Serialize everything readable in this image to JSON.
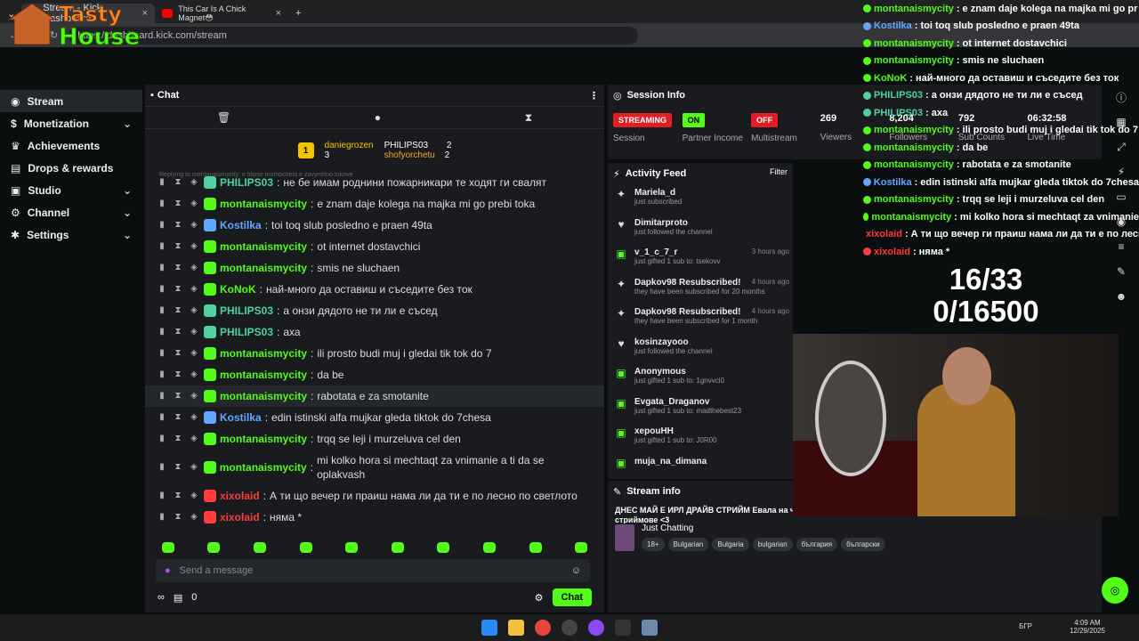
{
  "browser": {
    "tabs": [
      {
        "title": "Stream - Kick Dashboard"
      },
      {
        "title": "This Car Is A Chick Magnet😳"
      }
    ],
    "url": "https://dashboard.kick.com/stream",
    "new_tab": "+"
  },
  "logo": {
    "text1": "Tasty",
    "text2": "House"
  },
  "sidebar": {
    "items": [
      {
        "label": "Stream",
        "icon": "stream-icon",
        "chev": ""
      },
      {
        "label": "Monetization",
        "icon": "dollar-icon",
        "chev": "⌄"
      },
      {
        "label": "Achievements",
        "icon": "trophy-icon",
        "chev": ""
      },
      {
        "label": "Drops & rewards",
        "icon": "gift-icon",
        "chev": ""
      },
      {
        "label": "Studio",
        "icon": "studio-icon",
        "chev": "⌄"
      },
      {
        "label": "Channel",
        "icon": "channel-icon",
        "chev": "⌄"
      },
      {
        "label": "Settings",
        "icon": "gear-icon",
        "chev": "⌄"
      }
    ]
  },
  "chat": {
    "title": "Chat",
    "leader": {
      "u1": "daniegrozen",
      "c1": "3",
      "u2": "PHILIPS03",
      "c2": "2",
      "u3": "shofyorchetu",
      "c3": "2",
      "rank": "1"
    },
    "reply_hint": "Replying to montanaismycity: e filipse mombcheto e zavyrshno tokove",
    "messages": [
      {
        "user": "PHILIPS03",
        "color": "#4fd1a0",
        "text": "не бе имам роднини пожарникари те ходят ги свалят"
      },
      {
        "user": "montanaismycity",
        "color": "#53fc18",
        "text": "e znam daje kolega na majka mi go prebi toka"
      },
      {
        "user": "Kostilka",
        "color": "#62a7ff",
        "text": "toi toq slub posledno e praen 49ta"
      },
      {
        "user": "montanaismycity",
        "color": "#53fc18",
        "text": "ot internet dostavchici"
      },
      {
        "user": "montanaismycity",
        "color": "#53fc18",
        "text": "smis ne sluchaen"
      },
      {
        "user": "KoNoK",
        "color": "#53fc18",
        "text": "най-много да оставиш и съседите без ток"
      },
      {
        "user": "PHILIPS03",
        "color": "#4fd1a0",
        "text": "а онзи дядото не ти ли е съсед"
      },
      {
        "user": "PHILIPS03",
        "color": "#4fd1a0",
        "text": "аха"
      },
      {
        "user": "montanaismycity",
        "color": "#53fc18",
        "text": "ili prosto budi muj i gledai tik tok do 7"
      },
      {
        "user": "montanaismycity",
        "color": "#53fc18",
        "text": "da be"
      },
      {
        "user": "montanaismycity",
        "color": "#53fc18",
        "text": "rabotata e za smotanite"
      },
      {
        "user": "Kostilka",
        "color": "#62a7ff",
        "text": "edin istinski alfa mujkar gleda tiktok do 7chesa"
      },
      {
        "user": "montanaismycity",
        "color": "#53fc18",
        "text": "trqq se leji i murzeluva cel den"
      },
      {
        "user": "montanaismycity",
        "color": "#53fc18",
        "text": "mi kolko hora si mechtaqt za vnimanie a ti da se oplakvash"
      },
      {
        "user": "xixolaid",
        "color": "#ff3b3b",
        "text": "А ти що вечер ги праиш нама ли да ти е по лесно по светлото"
      },
      {
        "user": "xixolaid",
        "color": "#ff3b3b",
        "text": "няма *"
      }
    ],
    "input_placeholder": "Send a message",
    "footer_count": "0",
    "send_label": "Chat"
  },
  "session": {
    "title": "Session Info",
    "stats": [
      {
        "pill": "STREAMING",
        "pill_color": "#e01e24",
        "label": "Session"
      },
      {
        "pill": "ON",
        "pill_color": "#53fc18",
        "label": "Partner Income"
      },
      {
        "pill": "OFF",
        "pill_color": "#e01e24",
        "label": "Multistream"
      },
      {
        "value": "269",
        "label": "Viewers"
      },
      {
        "value": "8,204",
        "label": "Followers"
      },
      {
        "value": "792",
        "label": "Sub Counts"
      },
      {
        "value": "06:32:58",
        "label": "Live Time"
      }
    ]
  },
  "activity": {
    "title": "Activity Feed",
    "filter": "Filter",
    "items": [
      {
        "icon": "✦",
        "name": "Mariela_d",
        "sub": "just subscribed",
        "time": ""
      },
      {
        "icon": "♥",
        "name": "Dimitarproto",
        "sub": "just followed the channel",
        "time": ""
      },
      {
        "icon": "▣",
        "name": "v_1_c_7_r",
        "sub": "just gifted 1 sub to: tsekovv",
        "time": "3 hours ago"
      },
      {
        "icon": "✦",
        "name": "Dapkov98 Resubscribed!",
        "sub": "they have been subscribed for 20 months",
        "time": "4 hours ago"
      },
      {
        "icon": "✦",
        "name": "Dapkov98 Resubscribed!",
        "sub": "they have been subscribed for 1 month",
        "time": "4 hours ago"
      },
      {
        "icon": "♥",
        "name": "kosinzayooo",
        "sub": "just followed the channel",
        "time": ""
      },
      {
        "icon": "▣",
        "name": "Anonymous",
        "sub": "just gifted 1 sub to: 1gnvvci0",
        "time": ""
      },
      {
        "icon": "▣",
        "name": "Evgata_Draganov",
        "sub": "just gifted 1 sub to: madthebest23",
        "time": ""
      },
      {
        "icon": "▣",
        "name": "xepouHH",
        "sub": "just gifted 1 sub to: J0R00",
        "time": ""
      },
      {
        "icon": "▣",
        "name": "muja_na_dimana",
        "sub": "",
        "time": ""
      }
    ]
  },
  "stream_info": {
    "title": "Stream info",
    "stream_title": "ДНЕС МАЙ Е ИРЛ ДРАЙВ СТРИЙМ Евала на чата <3 Благодаря на всеки един от вас за вашата подкрепа стриймове <3",
    "category": "Just Chatting",
    "tags": [
      "18+",
      "Bulgarian",
      "Bulgaria",
      "bulgarian",
      "българия",
      "български"
    ]
  },
  "overlay": {
    "lines": [
      {
        "user": "montanaismycity",
        "color": "#53fc18",
        "text": "e znam daje kolega na majka mi go pr"
      },
      {
        "user": "Kostilka",
        "color": "#62a7ff",
        "text": "toi toq slub posledno e praen 49ta"
      },
      {
        "user": "montanaismycity",
        "color": "#53fc18",
        "text": "ot internet dostavchici"
      },
      {
        "user": "montanaismycity",
        "color": "#53fc18",
        "text": "smis ne sluchaen"
      },
      {
        "user": "KoNoK",
        "color": "#53fc18",
        "text": "най-много да оставиш и съседите без ток"
      },
      {
        "user": "PHILIPS03",
        "color": "#4fd1a0",
        "text": "а онзи дядото не ти ли е съсед"
      },
      {
        "user": "PHILIPS03",
        "color": "#4fd1a0",
        "text": "аха"
      },
      {
        "user": "montanaismycity",
        "color": "#53fc18",
        "text": "ili prosto budi muj i gledai tik tok do 7"
      },
      {
        "user": "montanaismycity",
        "color": "#53fc18",
        "text": "da be"
      },
      {
        "user": "montanaismycity",
        "color": "#53fc18",
        "text": "rabotata e za smotanite"
      },
      {
        "user": "Kostilka",
        "color": "#62a7ff",
        "text": "edin istinski alfa mujkar gleda tiktok do 7chesa"
      },
      {
        "user": "montanaismycity",
        "color": "#53fc18",
        "text": "trqq se leji i murzeluva cel den"
      },
      {
        "user": "montanaismycity",
        "color": "#53fc18",
        "text": "mi kolko hora si mechtaqt za vnimanie"
      },
      {
        "user": "xixolaid",
        "color": "#ff3b3b",
        "text": "А ти що вечер ги праиш нама ли да ти е по лесно"
      },
      {
        "user": "xixolaid",
        "color": "#ff3b3b",
        "text": "няма *"
      }
    ],
    "counter1": "16/33",
    "counter2": "0/16500"
  },
  "taskbar": {
    "time": "4:09 AM",
    "date": "12/29/2025",
    "lang": "БГР"
  },
  "colors": {
    "accent": "#53fc18",
    "panel": "#191b1f",
    "bg": "#0b0e0f"
  }
}
